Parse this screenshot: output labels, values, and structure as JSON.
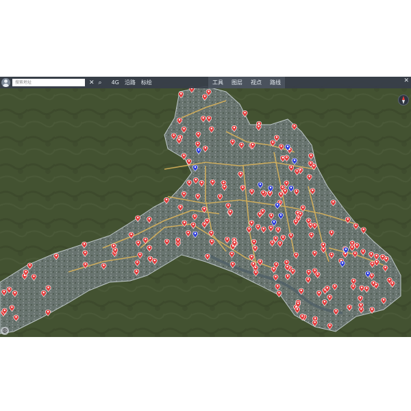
{
  "toolbar": {
    "search_placeholder": "搜索地址",
    "clear_icon": "close-icon",
    "search_icon": "search-icon",
    "buttons_left": [
      "4G",
      "沿路",
      "标绘"
    ],
    "buttons_right": [
      "工具",
      "图层",
      "视点",
      "路线"
    ],
    "close_icon": "close-icon"
  },
  "map": {
    "red_marker_count": 220,
    "blue_marker_count": 14,
    "colors": {
      "red_marker": "#e23a3a",
      "blue_marker": "#2f3fd8",
      "road": "#d9b25a",
      "toolbar": "#3a4150",
      "city_area": "#6d7a78",
      "terrain": "#3f4b33"
    },
    "compass_icon": "compass-icon",
    "zoom_icon": "globe-icon"
  }
}
